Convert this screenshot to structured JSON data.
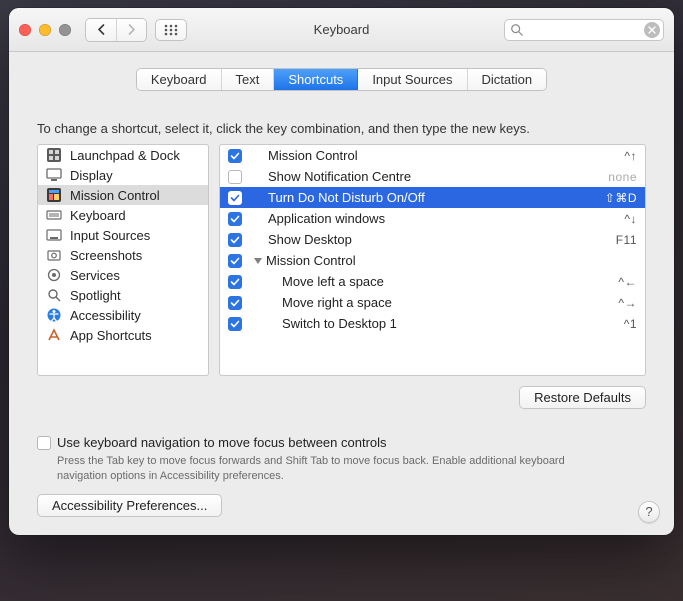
{
  "window": {
    "title": "Keyboard"
  },
  "search": {
    "placeholder": ""
  },
  "tabs": [
    {
      "label": "Keyboard"
    },
    {
      "label": "Text"
    },
    {
      "label": "Shortcuts"
    },
    {
      "label": "Input Sources"
    },
    {
      "label": "Dictation"
    }
  ],
  "instruction": "To change a shortcut, select it, click the key combination, and then type the new keys.",
  "categories": [
    {
      "label": "Launchpad & Dock"
    },
    {
      "label": "Display"
    },
    {
      "label": "Mission Control"
    },
    {
      "label": "Keyboard"
    },
    {
      "label": "Input Sources"
    },
    {
      "label": "Screenshots"
    },
    {
      "label": "Services"
    },
    {
      "label": "Spotlight"
    },
    {
      "label": "Accessibility"
    },
    {
      "label": "App Shortcuts"
    }
  ],
  "shortcuts": [
    {
      "checked": true,
      "label": "Mission Control",
      "keys": "^↑"
    },
    {
      "checked": false,
      "label": "Show Notification Centre",
      "keys": "none"
    },
    {
      "checked": true,
      "label": "Turn Do Not Disturb On/Off",
      "keys": "⇧⌘D"
    },
    {
      "checked": true,
      "label": "Application windows",
      "keys": "^↓"
    },
    {
      "checked": true,
      "label": "Show Desktop",
      "keys": "F11"
    },
    {
      "checked": true,
      "label": "Mission Control",
      "keys": ""
    },
    {
      "checked": true,
      "label": "Move left a space",
      "keys": "^←"
    },
    {
      "checked": true,
      "label": "Move right a space",
      "keys": "^→"
    },
    {
      "checked": true,
      "label": "Switch to Desktop 1",
      "keys": "^1"
    }
  ],
  "buttons": {
    "restore": "Restore Defaults",
    "accessibility": "Accessibility Preferences...",
    "help": "?"
  },
  "footer": {
    "checkbox_label": "Use keyboard navigation to move focus between controls",
    "help": "Press the Tab key to move focus forwards and Shift Tab to move focus back. Enable additional keyboard navigation options in Accessibility preferences."
  }
}
